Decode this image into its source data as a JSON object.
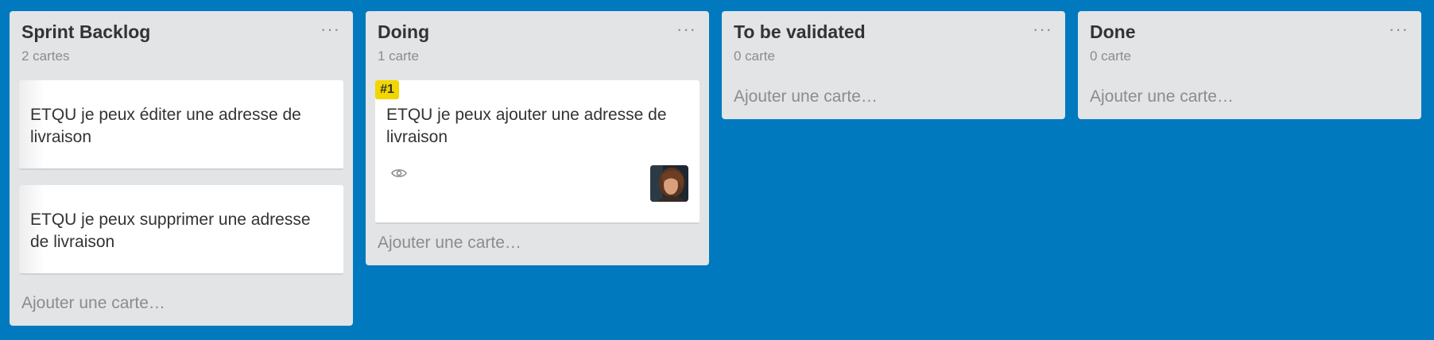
{
  "lists": [
    {
      "title": "Sprint Backlog",
      "count": "2 cartes",
      "cards": [
        {
          "text": "ETQU je peux éditer une adresse de livraison"
        },
        {
          "text": "ETQU je peux supprimer une adresse de livraison"
        }
      ],
      "add_label": "Ajouter une carte…"
    },
    {
      "title": "Doing",
      "count": "1 carte",
      "cards": [
        {
          "label": "#1",
          "text": "ETQU je peux ajouter une adresse de livraison",
          "watch_icon": "eye-icon",
          "member": "avatar"
        }
      ],
      "add_label": "Ajouter une carte…"
    },
    {
      "title": "To be validated",
      "count": "0 carte",
      "cards": [],
      "add_label": "Ajouter une carte…"
    },
    {
      "title": "Done",
      "count": "0 carte",
      "cards": [],
      "add_label": "Ajouter une carte…"
    }
  ],
  "menu_glyph": "···",
  "colors": {
    "board_bg": "#0079bf",
    "list_bg": "#e2e4e6",
    "label_yellow": "#f2d600"
  }
}
